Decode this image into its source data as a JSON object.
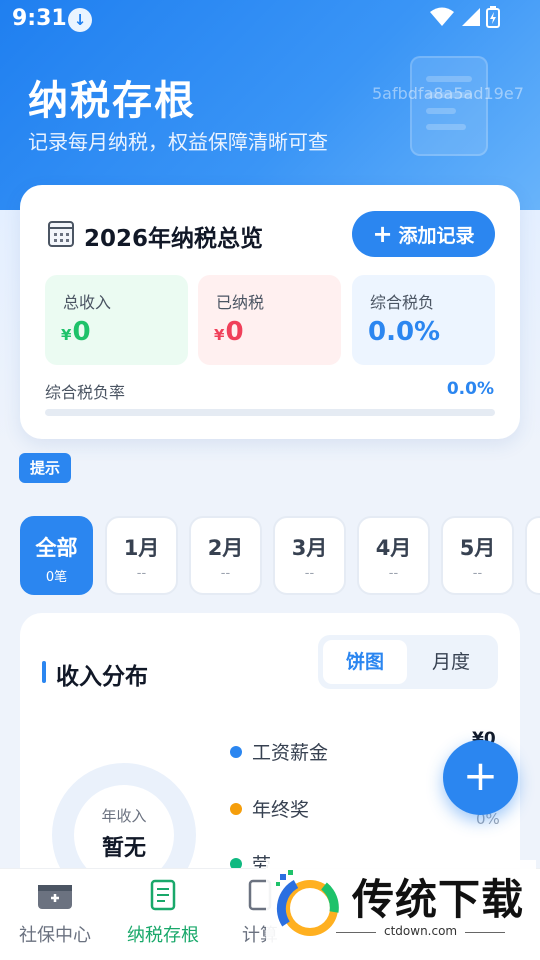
{
  "status_bar": {
    "time": "9:31"
  },
  "hero": {
    "title": "纳税存根",
    "subtitle": "记录每月纳税，权益保障清晰可查",
    "code": "5afbdfa8a5ad19e7"
  },
  "overview": {
    "title": "2026年纳税总览",
    "add_button": "添加记录",
    "stats": [
      {
        "label": "总收入",
        "currency": "¥",
        "value": "0",
        "color": "#1ec26a"
      },
      {
        "label": "已纳税",
        "currency": "¥",
        "value": "0",
        "color": "#f0405a"
      },
      {
        "label": "综合税负",
        "currency": "",
        "value": "0.0%",
        "color": "#2b86f0"
      }
    ],
    "rate_label": "综合税负率",
    "rate_value": "0.0%",
    "rate_fraction": 0.0
  },
  "tip_label": "提示",
  "months": [
    {
      "label": "全部",
      "count": "0笔",
      "active": true
    },
    {
      "label": "1月",
      "count": "--"
    },
    {
      "label": "2月",
      "count": "--"
    },
    {
      "label": "3月",
      "count": "--"
    },
    {
      "label": "4月",
      "count": "--"
    },
    {
      "label": "5月",
      "count": "--"
    }
  ],
  "distribution": {
    "title": "收入分布",
    "toggle": [
      "饼图",
      "月度"
    ],
    "donut_label": "年收入",
    "donut_value": "暂无",
    "legend": [
      {
        "label": "工资薪金",
        "color": "#2b86f0"
      },
      {
        "label": "年终奖",
        "color": "#f59e0b"
      },
      {
        "label": "劳",
        "color": "#10b981"
      }
    ],
    "amount": "¥0",
    "percent": "0%"
  },
  "tabbar": {
    "items": [
      "社保中心",
      "纳税存根",
      "计算"
    ],
    "active_color": "#19a86a"
  },
  "watermark": {
    "text": "传统下载",
    "url": "ctdown.com"
  }
}
